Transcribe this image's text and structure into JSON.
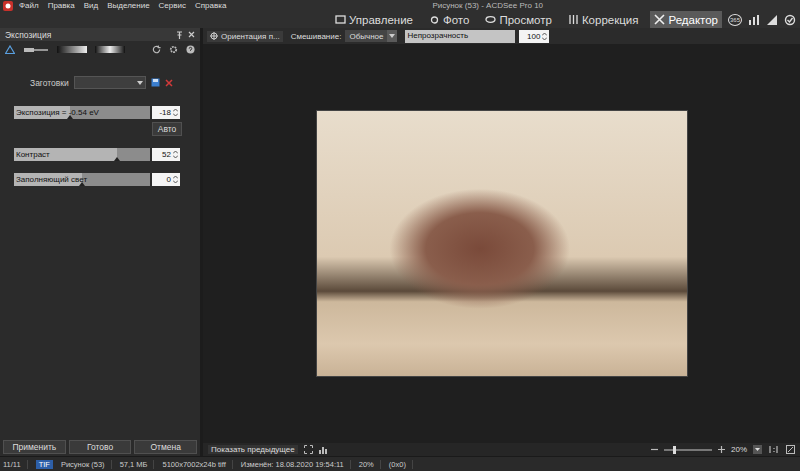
{
  "window": {
    "title": "Рисунок (53) - ACDSee Pro 10"
  },
  "menu": [
    "Файл",
    "Правка",
    "Вид",
    "Выделение",
    "Сервис",
    "Справка"
  ],
  "modes": [
    {
      "label": "Управление",
      "selected": false
    },
    {
      "label": "Фото",
      "selected": false
    },
    {
      "label": "Просмотр",
      "selected": false
    },
    {
      "label": "Коррекция",
      "selected": false
    },
    {
      "label": "Редактор",
      "selected": true
    }
  ],
  "badge": "365",
  "panel": {
    "title": "Экспозиция",
    "presets_label": "Заготовки",
    "presets_value": "",
    "sliders": [
      {
        "label": "Экспозиция = -0.54 eV",
        "value": "-18",
        "level": 0.41
      },
      {
        "label": "Контраст",
        "value": "52",
        "level": 0.76
      },
      {
        "label": "Заполняющий свет",
        "value": "0",
        "level": 0.5
      }
    ],
    "auto_button": "Авто",
    "footer_buttons": [
      "Применить",
      "Готово",
      "Отмена"
    ]
  },
  "toolbar": {
    "orientation": "Ориентация п...",
    "blend_label": "Смешивание:",
    "blend_value": "Обычное",
    "opacity_label": "Непрозрачность",
    "opacity_value": "100",
    "opacity_level": 1
  },
  "canvas": {
    "show_previous": "Показать предыдущее",
    "zoom": "20%",
    "zoom_level": 0.2
  },
  "status_bar": [
    "11/11",
    "TIF",
    "Рисунок (53)",
    "57,1 МБ",
    "5100x7002x24b tiff",
    "Изменён: 18.08.2020 19:54:11",
    "20%",
    "(0x0)"
  ]
}
